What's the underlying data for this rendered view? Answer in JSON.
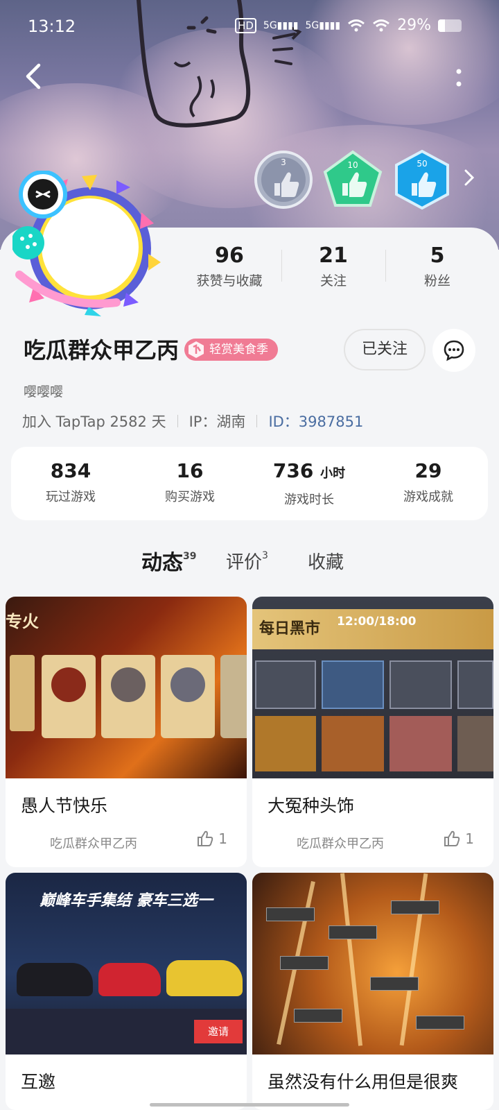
{
  "status_bar": {
    "time": "13:12",
    "battery": "29%",
    "battery_level": 0.29,
    "network_1": "5G",
    "network_2": "5G"
  },
  "badges": [
    {
      "level": "3",
      "name": "bronze-thumb-badge"
    },
    {
      "level": "10",
      "name": "green-thumb-badge"
    },
    {
      "level": "50",
      "name": "blue-thumb-badge"
    }
  ],
  "profile": {
    "counts": [
      {
        "value": "96",
        "label": "获赞与收藏"
      },
      {
        "value": "21",
        "label": "关注"
      },
      {
        "value": "5",
        "label": "粉丝"
      }
    ],
    "username": "吃瓜群众甲乙丙",
    "tag": "轻赏美食季",
    "follow_label": "已关注",
    "bio": "嘤嘤嘤",
    "joined": "加入 TapTap 2582 天",
    "ip": "IP：湖南",
    "id": "ID：3987851"
  },
  "stats": [
    {
      "value": "834",
      "unit": "",
      "label": "玩过游戏"
    },
    {
      "value": "16",
      "unit": "",
      "label": "购买游戏"
    },
    {
      "value": "736",
      "unit": "小时",
      "label": "游戏时长"
    },
    {
      "value": "29",
      "unit": "",
      "label": "游戏成就"
    }
  ],
  "tabs": [
    {
      "label": "动态",
      "count": "39"
    },
    {
      "label": "评价",
      "count": "3"
    },
    {
      "label": "收藏",
      "count": ""
    }
  ],
  "posts": [
    {
      "title": "愚人节快乐",
      "author": "吃瓜群众甲乙丙",
      "likes": "1",
      "thumb_text": "专火"
    },
    {
      "title": "大冤种头饰",
      "author": "吃瓜群众甲乙丙",
      "likes": "1",
      "thumb_text": "每日黑市",
      "thumb_time": "12:00/18:00"
    },
    {
      "title": "互邀",
      "author": "",
      "likes": "",
      "thumb_text": "巅峰车手集结 豪车三选一",
      "thumb_button": "邀请"
    },
    {
      "title": "虽然没有什么用但是很爽",
      "author": "",
      "likes": "",
      "thumb_text": ""
    }
  ]
}
